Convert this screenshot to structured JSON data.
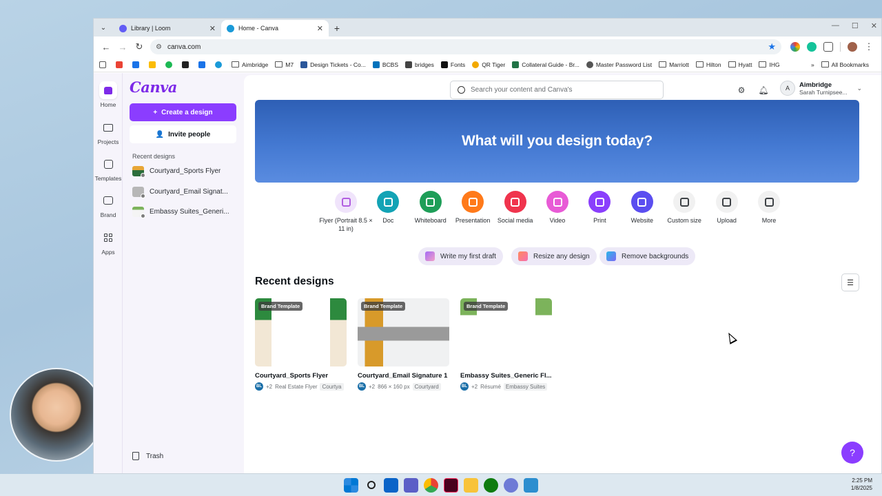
{
  "browser": {
    "tabs": [
      {
        "title": "Library | Loom",
        "favicon_color": "#625df5"
      },
      {
        "title": "Home - Canva",
        "favicon_color": "#1a9ad8"
      }
    ],
    "url": "canva.com",
    "bookmarks": [
      {
        "label": "Aimbridge",
        "kind": "folder"
      },
      {
        "label": "M7",
        "kind": "folder"
      },
      {
        "label": "Design Tickets - Co...",
        "kind": "site",
        "color": "#2b579a"
      },
      {
        "label": "BCBS",
        "kind": "site",
        "color": "#0072bc"
      },
      {
        "label": "bridges",
        "kind": "site",
        "color": "#444444"
      },
      {
        "label": "Fonts",
        "kind": "site",
        "color": "#111111"
      },
      {
        "label": "QR Tiger",
        "kind": "site",
        "color": "#f2a900"
      },
      {
        "label": "Collateral Guide - Br...",
        "kind": "site",
        "color": "#217346"
      },
      {
        "label": "Master Password List",
        "kind": "site",
        "color": "#555555"
      },
      {
        "label": "Marriott",
        "kind": "folder"
      },
      {
        "label": "Hilton",
        "kind": "folder"
      },
      {
        "label": "Hyatt",
        "kind": "folder"
      },
      {
        "label": "IHG",
        "kind": "folder"
      }
    ],
    "all_bookmarks": "All Bookmarks"
  },
  "rail": [
    {
      "label": "Home",
      "icon": "home-icon",
      "active": true
    },
    {
      "label": "Projects",
      "icon": "folder-icon"
    },
    {
      "label": "Templates",
      "icon": "templates-icon"
    },
    {
      "label": "Brand",
      "icon": "brand-icon"
    },
    {
      "label": "Apps",
      "icon": "apps-icon"
    }
  ],
  "sidebar": {
    "logo": "Canva",
    "create_label": "Create a design",
    "invite_label": "Invite people",
    "recent_label": "Recent designs",
    "recent": [
      {
        "name": "Courtyard_Sports Flyer"
      },
      {
        "name": "Courtyard_Email Signat..."
      },
      {
        "name": "Embassy Suites_Generi..."
      }
    ],
    "trash_label": "Trash"
  },
  "header": {
    "search_placeholder": "Search your content and Canva's",
    "org_name": "Aimbridge",
    "user_name": "Sarah Turnipsee..."
  },
  "hero": {
    "title": "What will you design today?"
  },
  "shortcuts": [
    {
      "label": "Flyer (Portrait 8.5 × 11 in)",
      "color": "#f0e4fb",
      "glyph": "#b15ee0"
    },
    {
      "label": "Doc",
      "color": "#13a3b5"
    },
    {
      "label": "Whiteboard",
      "color": "#1e9e58"
    },
    {
      "label": "Presentation",
      "color": "#ff7a1a"
    },
    {
      "label": "Social media",
      "color": "#f0344d"
    },
    {
      "label": "Video",
      "color": "#e85bd6"
    },
    {
      "label": "Print",
      "color": "#8a3ffc"
    },
    {
      "label": "Website",
      "color": "#5b4ef0"
    },
    {
      "label": "Custom size",
      "color": "#f1f1f1"
    },
    {
      "label": "Upload",
      "color": "#f1f1f1"
    },
    {
      "label": "More",
      "color": "#f1f1f1"
    }
  ],
  "pills": [
    {
      "label": "Write my first draft"
    },
    {
      "label": "Resize any design"
    },
    {
      "label": "Remove backgrounds"
    }
  ],
  "recent_section": {
    "title": "Recent designs"
  },
  "designs": [
    {
      "badge": "Brand Template",
      "name": "Courtyard_Sports Flyer",
      "owner": "BL",
      "extra": "+2",
      "type": "Real Estate Flyer",
      "tag": "Courtya"
    },
    {
      "badge": "Brand Template",
      "name": "Courtyard_Email Signature 1",
      "owner": "BL",
      "extra": "+2",
      "type": "866 × 160 px",
      "tag": "Courtyard"
    },
    {
      "badge": "Brand Template",
      "name": "Embassy Suites_Generic Fl...",
      "owner": "BL",
      "extra": "+2",
      "type": "Résumé",
      "tag": "Embassy Suites"
    }
  ],
  "help_label": "?",
  "clock": {
    "time": "2:25 PM",
    "date": "1/8/2025"
  }
}
